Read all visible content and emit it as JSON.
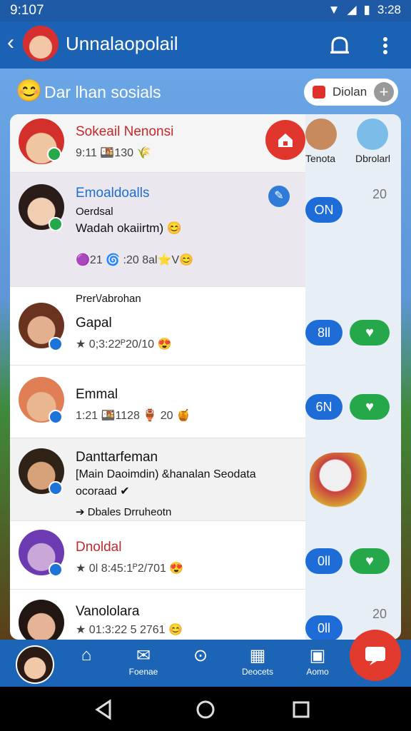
{
  "status": {
    "time": "9:107",
    "right_time": "3:28"
  },
  "appbar": {
    "title": "Unnalaopolail"
  },
  "section": {
    "title": "Dar lhan sosials",
    "pill_label": "Diolan",
    "pill_plus": "+"
  },
  "right_panel": {
    "top_labels": [
      "Tenota",
      "Dbrolarl"
    ],
    "numbers": [
      "20",
      "20"
    ],
    "on_labels": [
      "ON",
      "8ll",
      "6N",
      "0ll",
      "0ll"
    ]
  },
  "list": [
    {
      "name": "Sokeail Nenonsi",
      "meta": "9:11 🍱130 🌾",
      "color": "#c3292a"
    },
    {
      "name": "Emoaldoalls",
      "sub1": "Oerdsal",
      "sub2": "Wadah okaiirtm) 😊",
      "meta": "🟣21 🌀 :20 8al⭐V😊",
      "color": "#1d6fd0"
    },
    {
      "header": "Prer\\/abrohan",
      "name": "Gapal",
      "meta": "★ 0;3:22ᴾ20/10 😍",
      "color": "#111"
    },
    {
      "name": "Emmal",
      "meta": "1:21 🍱1128 🏺 20 🍯",
      "color": "#111"
    },
    {
      "name": "Danttarfeman",
      "sub1": "[Main Daoimdin) &hanalan Seodata",
      "sub2": "ocoraad ✔",
      "extra": "➔ Dbales Drruheotn",
      "color": "#111"
    },
    {
      "name": "Dnoldal",
      "meta": "★ 0l 8:45:1ᴾ2/701 😍",
      "color": "#c3292a"
    },
    {
      "name": "Vanololara",
      "meta": "★ 01:3:22 5 2761 😊",
      "color": "#111"
    }
  ],
  "bottomnav": {
    "items": [
      "",
      "Foenae",
      "",
      "Deocets",
      "Aomo"
    ]
  },
  "colors": {
    "primary": "#1b62b4",
    "accent_red": "#e1362e",
    "green": "#24a84a"
  }
}
